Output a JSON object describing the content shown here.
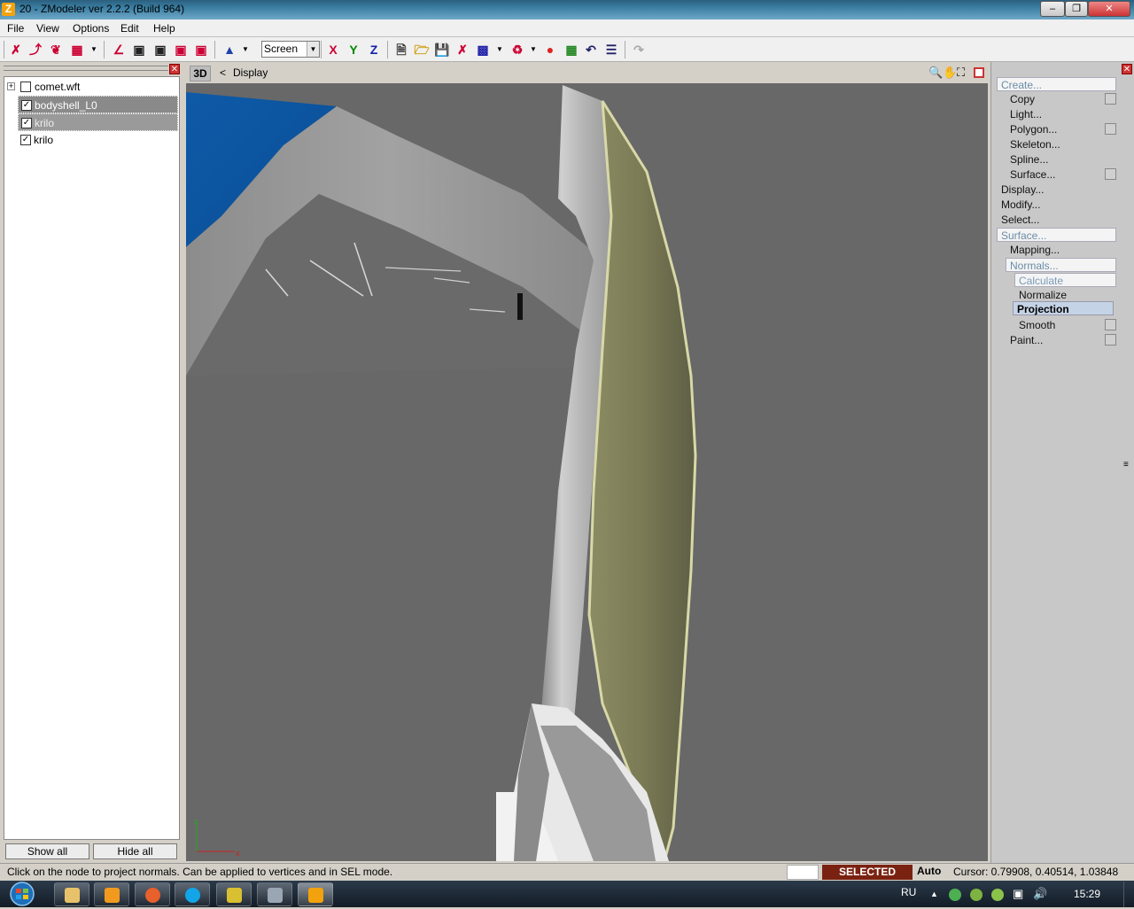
{
  "window": {
    "title": "20 - ZModeler ver 2.2.2 (Build 964)",
    "app_icon": "Z"
  },
  "menu": [
    {
      "label": "File",
      "underline": "F"
    },
    {
      "label": "View",
      "underline": "V"
    },
    {
      "label": "Options",
      "underline": "O"
    },
    {
      "label": "Edit",
      "underline": "E"
    },
    {
      "label": "Help",
      "underline": "H"
    }
  ],
  "toolbar": {
    "coord_select": "Screen",
    "axis_x": "X",
    "axis_y": "Y",
    "axis_z": "Z"
  },
  "tree": {
    "items": [
      {
        "label": "comet.wft",
        "checked": false,
        "expander": "+"
      },
      {
        "label": "bodyshell_L0",
        "checked": true
      },
      {
        "label": "krilo",
        "checked": true
      },
      {
        "label": "krilo",
        "checked": true
      }
    ],
    "show_all": "Show all",
    "hide_all": "Hide all"
  },
  "viewport": {
    "mode": "3D",
    "breadcrumb_sep": "<",
    "breadcrumb": "Display",
    "axis_z": "z",
    "axis_x": "x"
  },
  "command_panel": {
    "create": "Create...",
    "copy": "Copy",
    "light": "Light...",
    "polygon": "Polygon...",
    "skeleton": "Skeleton...",
    "spline": "Spline...",
    "surface_sub": "Surface...",
    "display": "Display...",
    "modify": "Modify...",
    "select": "Select...",
    "surface": "Surface...",
    "mapping": "Mapping...",
    "normals": "Normals...",
    "calculate": "Calculate",
    "normalize": "Normalize",
    "projection": "Projection",
    "smooth": "Smooth",
    "paint": "Paint..."
  },
  "status": {
    "hint": "Click on the node to project normals. Can be applied to vertices and in SEL mode.",
    "mode": "SELECTED MODE",
    "auto": "Auto",
    "cursor": "Cursor: 0.79908, 0.40514, 1.03848"
  },
  "taskbar": {
    "lang": "RU",
    "time": "15:29"
  }
}
